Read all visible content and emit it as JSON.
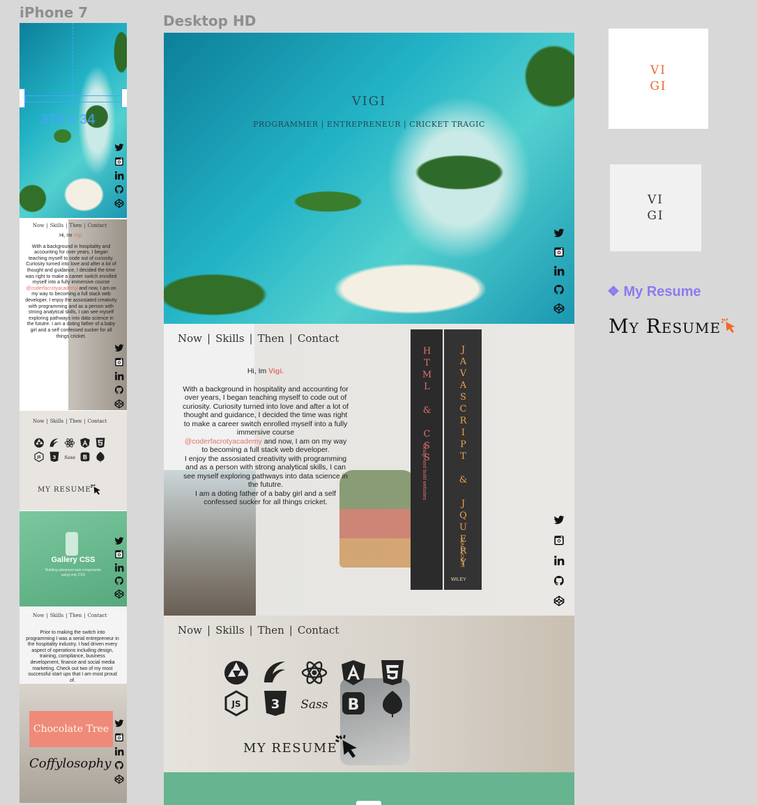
{
  "frames": {
    "iphone_title": "iPhone 7",
    "desktop_title": "Desktop HD"
  },
  "hero": {
    "name": "VIGI",
    "tagline": "PROGRAMMER | ENTREPRENEUR | CRICKET TRAGIC"
  },
  "nav": {
    "now": "Now",
    "skills": "Skills",
    "then": "Then",
    "contact": "Contact",
    "sep": "|"
  },
  "about": {
    "greeting_prefix": "Hi, Im ",
    "greeting_name": "Vigi.",
    "para1": "With a background in hospitality and accounting for over years, I began teaching myself to code out of curiosity. Curiosity turned into love and after a lot of thought and guidance, I decided the time was right to make a career switch enrolled myself into a fully immersive course",
    "handle": "@coderfacrotyacademy",
    "para2": " and now, I am on my way to becoming a full stack web developer.",
    "para3": "I enjoy the assosiated creativity with programming and as a person with strong analytical skills, I can see myself exploring pathways into data science in the fututre.",
    "para4": "I am a doting father of a baby girl and a self confessed sucker for all things cricket."
  },
  "books": {
    "book1": "HTML & CSS",
    "book1_sub": "design and build websites",
    "book2": "JAVASCRIPT & JQUERY",
    "book2_author": "JON DUCKETT",
    "publisher": "WILEY"
  },
  "skills": {
    "resume_label": "MY RESUME"
  },
  "mobile": {
    "dimension": "375 × 34",
    "gallery_title": "Gallery CSS",
    "gallery_sub": "Building advanced web components using only CSS",
    "then_text": "Prior to making the switch into programming I was a serial entrepreneur in the hospitality industry. I had driven every aspect of operations including design, training, compliance, business development, finance and social media marketing. Check out two of my most successful start ups that I am most proud of.",
    "chocolate_tree": "Chocolate Tree",
    "coffylosophy": "Coffylosophy"
  },
  "side": {
    "logo1_line1": "VI",
    "logo1_line2": "GI",
    "logo2_line1": "VI",
    "logo2_line2": "GI",
    "resume_link": "❖ My Resume",
    "resume_big": "My Resume"
  },
  "colors": {
    "accent": "#e2706c",
    "logo_orange": "#e6692b",
    "link_purple": "#8b7bf0",
    "green": "#66b590"
  },
  "icons": [
    "twitter-icon",
    "instagram-icon",
    "linkedin-icon",
    "github-icon",
    "codepen-icon"
  ]
}
